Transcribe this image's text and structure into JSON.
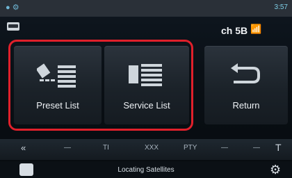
{
  "status_bar": {
    "clock": "3:57"
  },
  "header": {
    "channel": "ch 5B"
  },
  "tiles": [
    {
      "label": "Preset List",
      "icon": "preset-list-icon"
    },
    {
      "label": "Service List",
      "icon": "service-list-icon"
    },
    {
      "label": "Return",
      "icon": "return-arrow-icon"
    }
  ],
  "bottom_controls": {
    "prev": "«",
    "dash1": "—",
    "ti": "TI",
    "tui": "XXX",
    "pty": "PTY",
    "dash2": "—",
    "dash3": "—",
    "tp": "T"
  },
  "footer": {
    "status": "Locating Satellites"
  },
  "colors": {
    "highlight": "#e0202b",
    "status_bar": "#2a3038"
  }
}
